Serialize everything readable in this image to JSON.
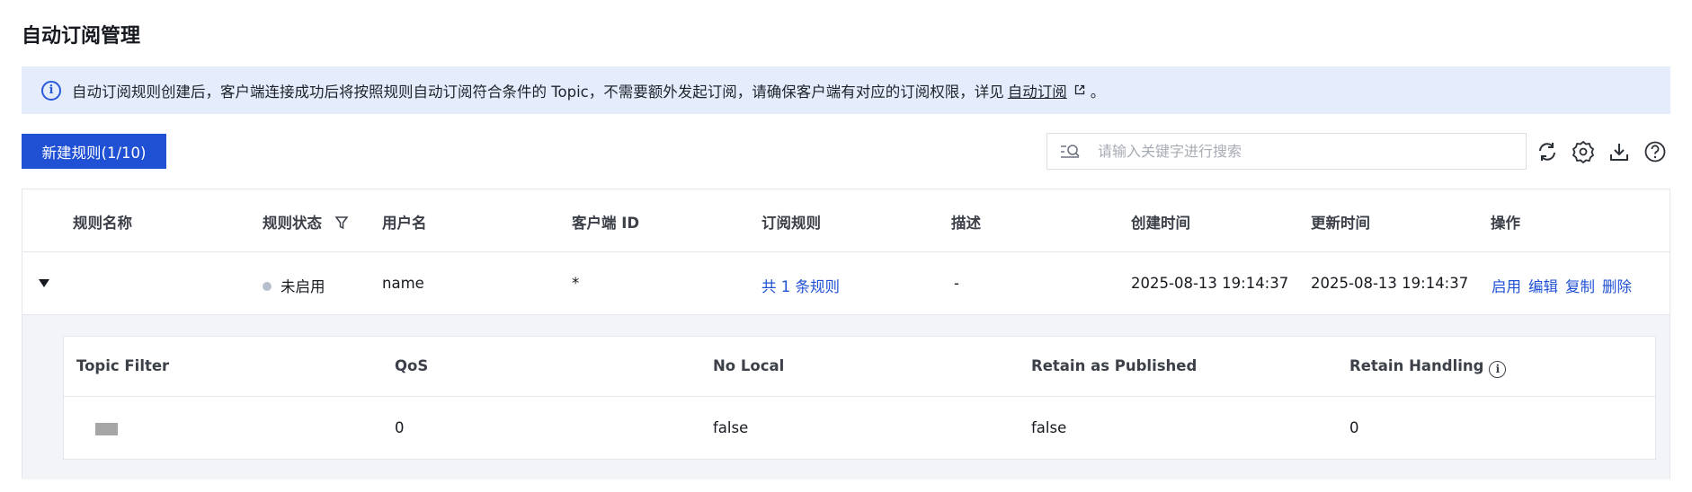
{
  "page": {
    "title": "自动订阅管理"
  },
  "notice": {
    "text": "自动订阅规则创建后，客户端连接成功后将按照规则自动订阅符合条件的 Topic，不需要额外发起订阅，请确保客户端有对应的订阅权限，详见",
    "link": "自动订阅",
    "suffix": "。"
  },
  "toolbar": {
    "create_button": "新建规则(1/10)",
    "search_placeholder": "请输入关键字进行搜索",
    "icons": [
      "refresh-icon",
      "settings-icon",
      "download-icon",
      "help-icon"
    ]
  },
  "table": {
    "columns": [
      "规则名称",
      "规则状态",
      "用户名",
      "客户端 ID",
      "订阅规则",
      "描述",
      "创建时间",
      "更新时间",
      "操作"
    ],
    "rows": [
      {
        "name": "",
        "status": "未启用",
        "username": "name",
        "client_id": "*",
        "rules": "共 1 条规则",
        "description": "-",
        "created": "2025-08-13 19:14:37",
        "updated": "2025-08-13 19:14:37",
        "actions": [
          "启用",
          "编辑",
          "复制",
          "删除"
        ]
      }
    ]
  },
  "subtable": {
    "columns": [
      "Topic Filter",
      "QoS",
      "No Local",
      "Retain as Published",
      "Retain Handling"
    ],
    "rows": [
      {
        "topic_filter": "",
        "qos": "0",
        "no_local": "false",
        "retain_as_published": "false",
        "retain_handling": "0"
      }
    ]
  },
  "colors": {
    "primary": "#2051d4",
    "notice_bg": "#e5edfd",
    "status_inactive": "#b8bfcc"
  }
}
